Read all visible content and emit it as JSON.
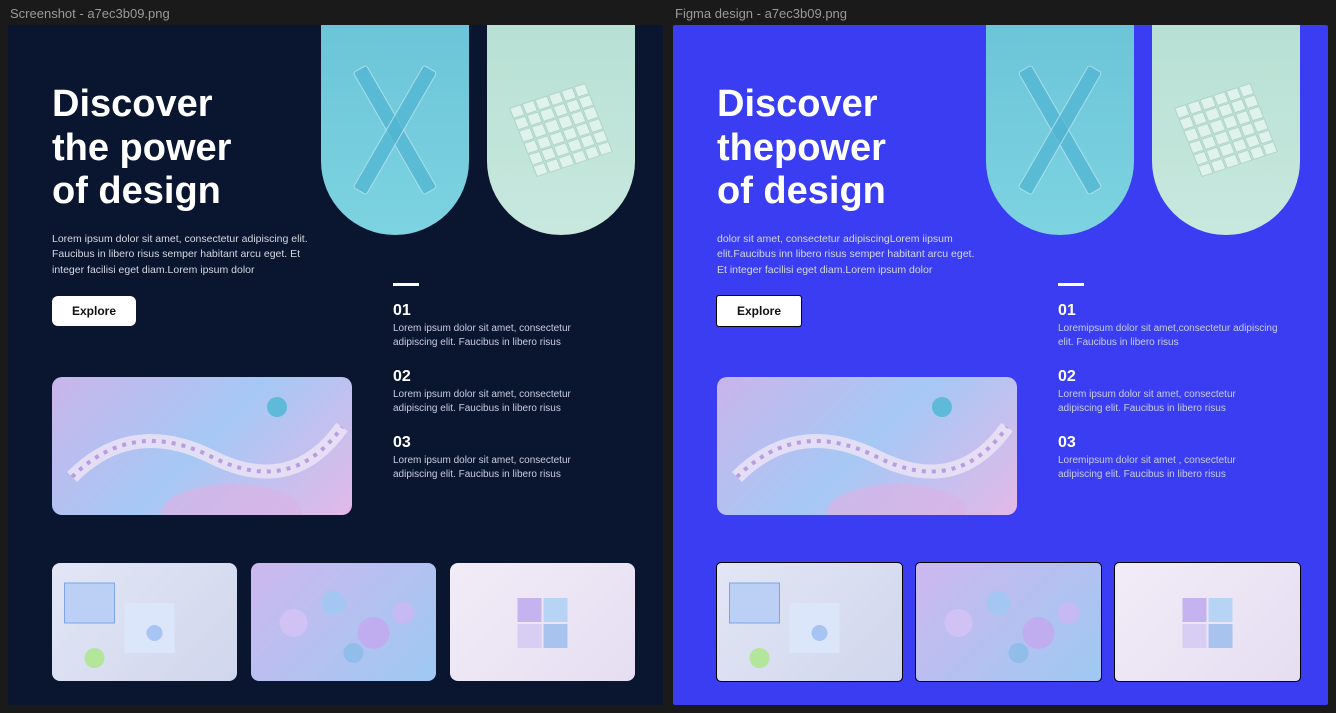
{
  "labels": {
    "left": "Screenshot - a7ec3b09.png",
    "right": "Figma design - a7ec3b09.png"
  },
  "left": {
    "hero_line1": "Discover",
    "hero_line2": "the power",
    "hero_line3": "of design",
    "hero_body": "Lorem ipsum dolor sit amet, consectetur adipiscing elit. Faucibus in libero risus semper habitant arcu eget. Et integer facilisi eget diam.Lorem ipsum dolor",
    "explore": "Explore",
    "items": [
      {
        "n": "01",
        "d": "Lorem ipsum dolor sit amet, consectetur adipiscing elit. Faucibus in libero risus"
      },
      {
        "n": "02",
        "d": "Lorem ipsum dolor sit amet, consectetur adipiscing elit. Faucibus in libero risus"
      },
      {
        "n": "03",
        "d": "Lorem ipsum dolor sit amet, consectetur adipiscing elit. Faucibus in libero risus"
      }
    ]
  },
  "right": {
    "hero_line1": "Discover",
    "hero_line2": "thepower",
    "hero_line3": "of design",
    "hero_body": " dolor sit amet, consectetur adipiscingLorem iipsum elit.Faucibus inn libero risus semper habitant arcu eget. Et integer facilisi eget diam.Lorem ipsum dolor",
    "explore": "Explore",
    "items": [
      {
        "n": "01",
        "d": "Loremipsum dolor sit amet,consectetur adipiscing elit. Faucibus in libero risus"
      },
      {
        "n": "02",
        "d": "Lorem ipsum dolor sit amet, consectetur adipiscing elit. Faucibus in libero risus"
      },
      {
        "n": "03",
        "d": "Loremipsum dolor sit amet , consectetur adipiscing elit. Faucibus in libero risus"
      }
    ]
  }
}
